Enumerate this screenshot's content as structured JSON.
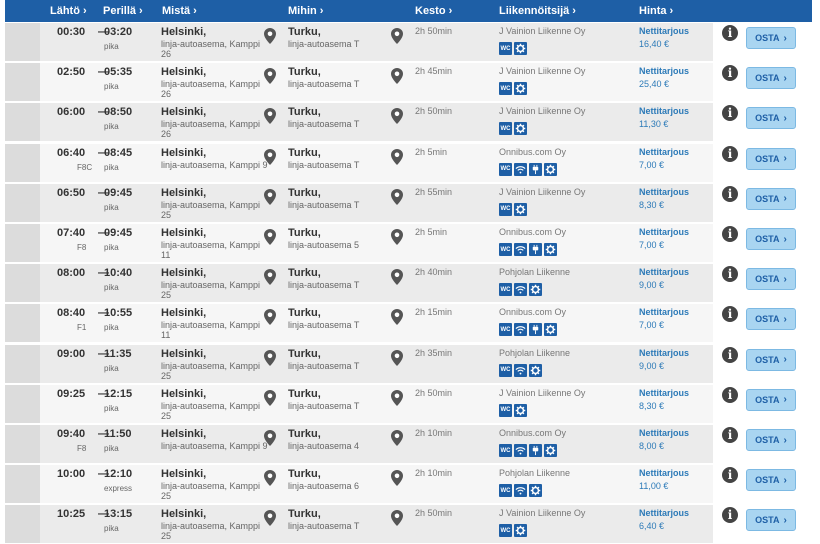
{
  "header": {
    "columns": [
      {
        "key": "departure",
        "label": "Lähtö"
      },
      {
        "key": "arrival",
        "label": "Perillä"
      },
      {
        "key": "from",
        "label": "Mistä"
      },
      {
        "key": "to",
        "label": "Mihin"
      },
      {
        "key": "duration",
        "label": "Kesto"
      },
      {
        "key": "operator",
        "label": "Liikennöitsijä"
      },
      {
        "key": "price",
        "label": "Hinta"
      }
    ]
  },
  "buy_label": "OSTA",
  "info_symbol": "i",
  "amenity_labels": {
    "wc": "WC"
  },
  "rows": [
    {
      "dep": "00:30",
      "arr": "03:20",
      "dep_note": "",
      "arr_note": "pika",
      "from_city": "Helsinki,",
      "from_station": "linja-autoasema, Kamppi 26",
      "to_city": "Turku,",
      "to_station": "linja-autoasema T",
      "duration": "2h 50min",
      "operator": "J Vainion Liikenne Oy",
      "amenities": [
        "wc",
        "gear"
      ],
      "price_type": "Nettitarjous",
      "price": "16,40 €"
    },
    {
      "dep": "02:50",
      "arr": "05:35",
      "dep_note": "",
      "arr_note": "pika",
      "from_city": "Helsinki,",
      "from_station": "linja-autoasema, Kamppi 26",
      "to_city": "Turku,",
      "to_station": "linja-autoasema T",
      "duration": "2h 45min",
      "operator": "J Vainion Liikenne Oy",
      "amenities": [
        "wc",
        "gear"
      ],
      "price_type": "Nettitarjous",
      "price": "25,40 €"
    },
    {
      "dep": "06:00",
      "arr": "08:50",
      "dep_note": "",
      "arr_note": "pika",
      "from_city": "Helsinki,",
      "from_station": "linja-autoasema, Kamppi 26",
      "to_city": "Turku,",
      "to_station": "linja-autoasema T",
      "duration": "2h 50min",
      "operator": "J Vainion Liikenne Oy",
      "amenities": [
        "wc",
        "gear"
      ],
      "price_type": "Nettitarjous",
      "price": "11,30 €"
    },
    {
      "dep": "06:40",
      "arr": "08:45",
      "dep_note": "F8C",
      "arr_note": "pika",
      "from_city": "Helsinki,",
      "from_station": "linja-autoasema, Kamppi 9",
      "to_city": "Turku,",
      "to_station": "linja-autoasema T",
      "duration": "2h 5min",
      "operator": "Onnibus.com Oy",
      "amenities": [
        "wc",
        "wifi",
        "plug",
        "gear"
      ],
      "price_type": "Nettitarjous",
      "price": "7,00 €"
    },
    {
      "dep": "06:50",
      "arr": "09:45",
      "dep_note": "",
      "arr_note": "pika",
      "from_city": "Helsinki,",
      "from_station": "linja-autoasema, Kamppi 25",
      "to_city": "Turku,",
      "to_station": "linja-autoasema T",
      "duration": "2h 55min",
      "operator": "J Vainion Liikenne Oy",
      "amenities": [
        "wc",
        "gear"
      ],
      "price_type": "Nettitarjous",
      "price": "8,30 €"
    },
    {
      "dep": "07:40",
      "arr": "09:45",
      "dep_note": "F8",
      "arr_note": "pika",
      "from_city": "Helsinki,",
      "from_station": "linja-autoasema, Kamppi 11",
      "to_city": "Turku,",
      "to_station": "linja-autoasema 5",
      "duration": "2h 5min",
      "operator": "Onnibus.com Oy",
      "amenities": [
        "wc",
        "wifi",
        "plug",
        "gear"
      ],
      "price_type": "Nettitarjous",
      "price": "7,00 €"
    },
    {
      "dep": "08:00",
      "arr": "10:40",
      "dep_note": "",
      "arr_note": "pika",
      "from_city": "Helsinki,",
      "from_station": "linja-autoasema, Kamppi 25",
      "to_city": "Turku,",
      "to_station": "linja-autoasema T",
      "duration": "2h 40min",
      "operator": "Pohjolan Liikenne",
      "amenities": [
        "wc",
        "wifi",
        "gear"
      ],
      "price_type": "Nettitarjous",
      "price": "9,00 €"
    },
    {
      "dep": "08:40",
      "arr": "10:55",
      "dep_note": "F1",
      "arr_note": "pika",
      "from_city": "Helsinki,",
      "from_station": "linja-autoasema, Kamppi 11",
      "to_city": "Turku,",
      "to_station": "linja-autoasema T",
      "duration": "2h 15min",
      "operator": "Onnibus.com Oy",
      "amenities": [
        "wc",
        "wifi",
        "plug",
        "gear"
      ],
      "price_type": "Nettitarjous",
      "price": "7,00 €"
    },
    {
      "dep": "09:00",
      "arr": "11:35",
      "dep_note": "",
      "arr_note": "pika",
      "from_city": "Helsinki,",
      "from_station": "linja-autoasema, Kamppi 25",
      "to_city": "Turku,",
      "to_station": "linja-autoasema T",
      "duration": "2h 35min",
      "operator": "Pohjolan Liikenne",
      "amenities": [
        "wc",
        "wifi",
        "gear"
      ],
      "price_type": "Nettitarjous",
      "price": "9,00 €"
    },
    {
      "dep": "09:25",
      "arr": "12:15",
      "dep_note": "",
      "arr_note": "pika",
      "from_city": "Helsinki,",
      "from_station": "linja-autoasema, Kamppi 25",
      "to_city": "Turku,",
      "to_station": "linja-autoasema T",
      "duration": "2h 50min",
      "operator": "J Vainion Liikenne Oy",
      "amenities": [
        "wc",
        "gear"
      ],
      "price_type": "Nettitarjous",
      "price": "8,30 €"
    },
    {
      "dep": "09:40",
      "arr": "11:50",
      "dep_note": "F8",
      "arr_note": "pika",
      "from_city": "Helsinki,",
      "from_station": "linja-autoasema, Kamppi 9",
      "to_city": "Turku,",
      "to_station": "linja-autoasema 4",
      "duration": "2h 10min",
      "operator": "Onnibus.com Oy",
      "amenities": [
        "wc",
        "wifi",
        "plug",
        "gear"
      ],
      "price_type": "Nettitarjous",
      "price": "8,00 €"
    },
    {
      "dep": "10:00",
      "arr": "12:10",
      "dep_note": "",
      "arr_note": "express",
      "from_city": "Helsinki,",
      "from_station": "linja-autoasema, Kamppi 25",
      "to_city": "Turku,",
      "to_station": "linja-autoasema 6",
      "duration": "2h 10min",
      "operator": "Pohjolan Liikenne",
      "amenities": [
        "wc",
        "wifi",
        "gear"
      ],
      "price_type": "Nettitarjous",
      "price": "11,00 €"
    },
    {
      "dep": "10:25",
      "arr": "13:15",
      "dep_note": "",
      "arr_note": "pika",
      "from_city": "Helsinki,",
      "from_station": "linja-autoasema, Kamppi 25",
      "to_city": "Turku,",
      "to_station": "linja-autoasema T",
      "duration": "2h 50min",
      "operator": "J Vainion Liikenne Oy",
      "amenities": [
        "wc",
        "gear"
      ],
      "price_type": "Nettitarjous",
      "price": "6,40 €"
    }
  ]
}
